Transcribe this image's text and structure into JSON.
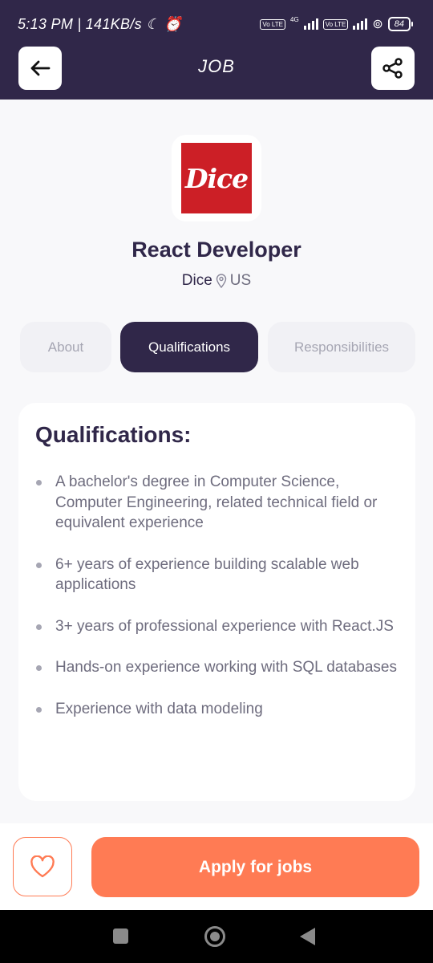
{
  "status_bar": {
    "time": "5:13 PM",
    "speed": "141KB/s",
    "network_label": "4G",
    "volte_label": "Vo LTE",
    "battery": "84"
  },
  "header": {
    "title": "JOB",
    "back_icon": "arrow-left-icon",
    "share_icon": "share-icon"
  },
  "job": {
    "company_logo_text": "Dice",
    "title": "React Developer",
    "company": "Dice",
    "location": "US",
    "location_icon": "map-pin-icon"
  },
  "tabs": [
    {
      "label": "About",
      "active": false
    },
    {
      "label": "Qualifications",
      "active": true
    },
    {
      "label": "Responsibilities",
      "active": false
    }
  ],
  "qualifications": {
    "heading": "Qualifications:",
    "items": [
      "A bachelor's degree in Computer Science, Computer Engineering, related technical field or equivalent experience",
      "6+ years of experience building scalable web applications",
      "3+ years of professional experience with React.JS",
      "Hands-on experience working with SQL databases",
      "Experience with data modeling"
    ]
  },
  "footer": {
    "favorite_icon": "heart-icon",
    "apply_label": "Apply for jobs"
  },
  "colors": {
    "primary": "#302749",
    "accent": "#ff7b54",
    "logo_red": "#cc1f26"
  }
}
